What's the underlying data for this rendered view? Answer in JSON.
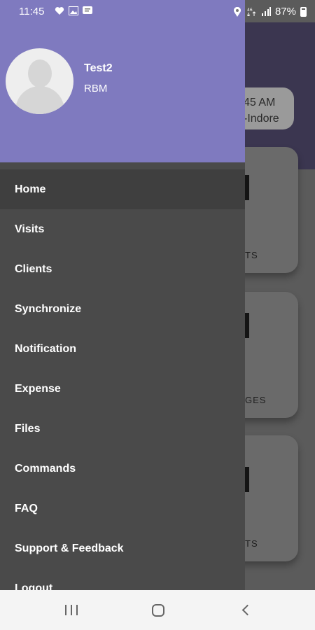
{
  "status_bar": {
    "time": "11:45",
    "battery": "87%",
    "left_icons": [
      "heart-monitor-icon",
      "image-icon",
      "message-icon"
    ],
    "right_icons": [
      "location-icon",
      "data-icon",
      "signal-icon",
      "battery-icon"
    ]
  },
  "background": {
    "chip_line1": "45 AM",
    "chip_line2": "-Indore",
    "cards": [
      {
        "label": "TS"
      },
      {
        "label": "GES"
      },
      {
        "label": "TS"
      }
    ]
  },
  "drawer": {
    "user_name": "Test2",
    "user_role": "RBM",
    "menu": [
      {
        "label": "Home",
        "active": true
      },
      {
        "label": "Visits"
      },
      {
        "label": "Clients"
      },
      {
        "label": "Synchronize"
      },
      {
        "label": "Notification"
      },
      {
        "label": "Expense"
      },
      {
        "label": "Files"
      },
      {
        "label": "Commands"
      },
      {
        "label": "FAQ"
      },
      {
        "label": "Support & Feedback"
      },
      {
        "label": "Logout"
      }
    ]
  },
  "nav_bar": {
    "buttons": [
      "recents-icon",
      "home-icon",
      "back-icon"
    ]
  },
  "colors": {
    "drawer_header": "#7f7abf",
    "drawer_bg": "#4a4a4a",
    "active_item": "#3f3f3f"
  }
}
